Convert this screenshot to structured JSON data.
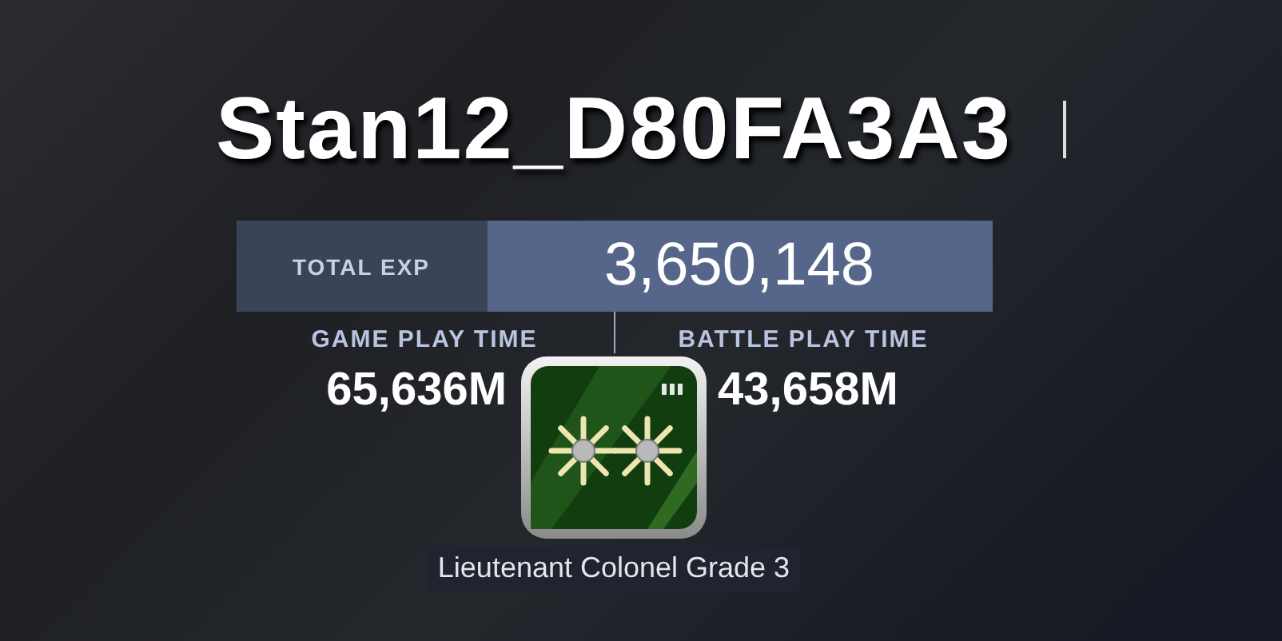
{
  "player_name": "Stan12_D80FA3A3",
  "total_exp": {
    "label": "TOTAL EXP",
    "value": "3,650,148"
  },
  "stats": [
    {
      "label": "GAME PLAY TIME",
      "value": "65,636M"
    },
    {
      "label": "BATTLE PLAY TIME",
      "value": "43,658M"
    }
  ],
  "rank": {
    "title": "Lieutenant Colonel Grade 3"
  }
}
